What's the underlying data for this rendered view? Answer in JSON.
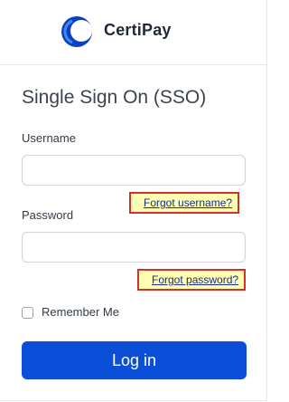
{
  "brand": {
    "name": "CertiPay",
    "icon": "certipay-logo-icon",
    "colors": {
      "logo_dark": "#0b3fc4",
      "logo_light": "#3a8bf0"
    }
  },
  "form": {
    "title": "Single Sign On (SSO)",
    "username": {
      "label": "Username",
      "value": "",
      "placeholder": ""
    },
    "forgot_username": "Forgot username?",
    "password": {
      "label": "Password",
      "value": "",
      "placeholder": ""
    },
    "forgot_password": "Forgot password?",
    "remember_me": {
      "label": "Remember Me",
      "checked": false
    },
    "login_label": "Log in"
  },
  "colors": {
    "primary": "#0b4ed8",
    "highlight_fill": "#ffffb3",
    "highlight_border": "#d32f2f",
    "link": "#1a2b8a"
  }
}
